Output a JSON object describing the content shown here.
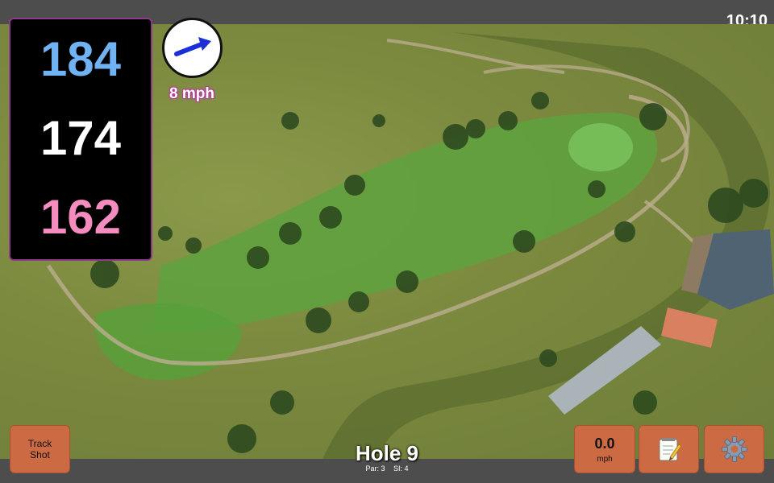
{
  "status": {
    "time": "10:10"
  },
  "distances": {
    "back": "184",
    "middle": "174",
    "front": "162"
  },
  "wind": {
    "speed_label": "8 mph",
    "arrow_icon": "arrow-right-icon"
  },
  "track_button": {
    "line1": "Track",
    "line2": "Shot"
  },
  "hole": {
    "title": "Hole 9",
    "par": "Par: 3",
    "si": "SI: 4"
  },
  "wind_button": {
    "value": "0.0",
    "unit": "mph"
  },
  "notes_button": {
    "icon": "notepad-icon"
  },
  "settings_button": {
    "icon": "gear-icon"
  },
  "colors": {
    "back": "#6fb3f2",
    "middle": "#ffffff",
    "front": "#f58cc0",
    "button": "#cc6b43"
  }
}
